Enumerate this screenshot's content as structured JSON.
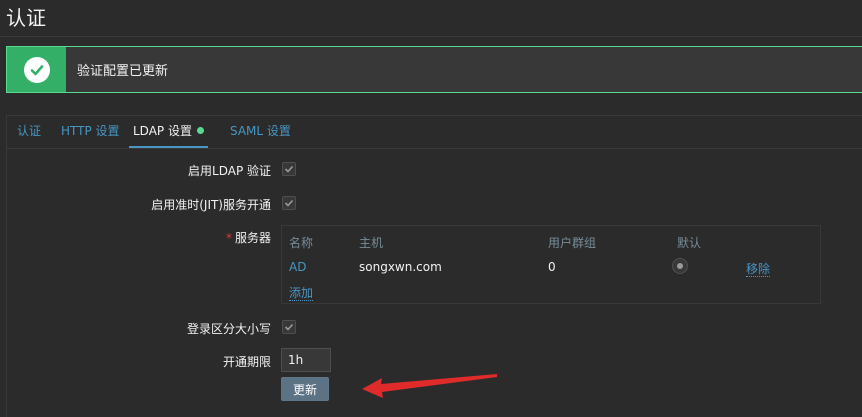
{
  "page": {
    "title": "认证"
  },
  "message": {
    "text": "验证配置已更新",
    "status": "success",
    "accent": "#34af67"
  },
  "tabs": [
    {
      "label": "认证",
      "active": false
    },
    {
      "label": "HTTP 设置",
      "active": false
    },
    {
      "label": "LDAP 设置",
      "active": true,
      "has_indicator": true
    },
    {
      "label": "SAML 设置",
      "active": false
    }
  ],
  "form": {
    "enable_ldap": {
      "label": "启用LDAP 验证",
      "checked": true
    },
    "enable_jit": {
      "label": "启用准时(JIT)服务开通",
      "checked": true
    },
    "servers": {
      "label": "服务器",
      "required": true,
      "columns": [
        "名称",
        "主机",
        "用户群组",
        "默认"
      ],
      "rows": [
        {
          "name": "AD",
          "host": "songxwn.com",
          "user_groups": "0",
          "default": true,
          "remove_label": "移除"
        }
      ],
      "add_label": "添加"
    },
    "case_sensitive": {
      "label": "登录区分大小写",
      "checked": true
    },
    "provisioning_period": {
      "label": "开通期限",
      "value": "1h"
    },
    "submit_label": "更新"
  },
  "colors": {
    "background": "#2b2b2b",
    "link": "#4796c4",
    "annotation_arrow": "#e02b2b"
  }
}
